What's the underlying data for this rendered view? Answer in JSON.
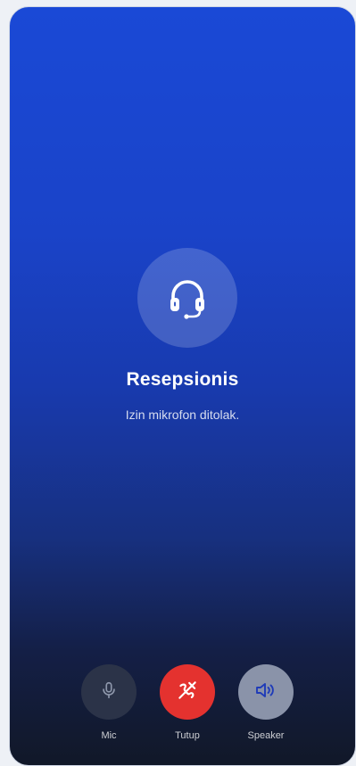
{
  "call": {
    "caller_name": "Resepsionis",
    "status": "Izin mikrofon ditolak."
  },
  "controls": {
    "mic_label": "Mic",
    "hangup_label": "Tutup",
    "speaker_label": "Speaker"
  },
  "icons": {
    "avatar": "headset-icon",
    "mic": "microphone-icon",
    "hangup": "phone-hangup-icon",
    "speaker": "speaker-icon"
  },
  "colors": {
    "gradient_top": "#1a49d6",
    "gradient_bottom": "#111828",
    "hangup": "#e4322f",
    "mic_button": "#2b3348",
    "speaker_button": "#8a93a9"
  }
}
